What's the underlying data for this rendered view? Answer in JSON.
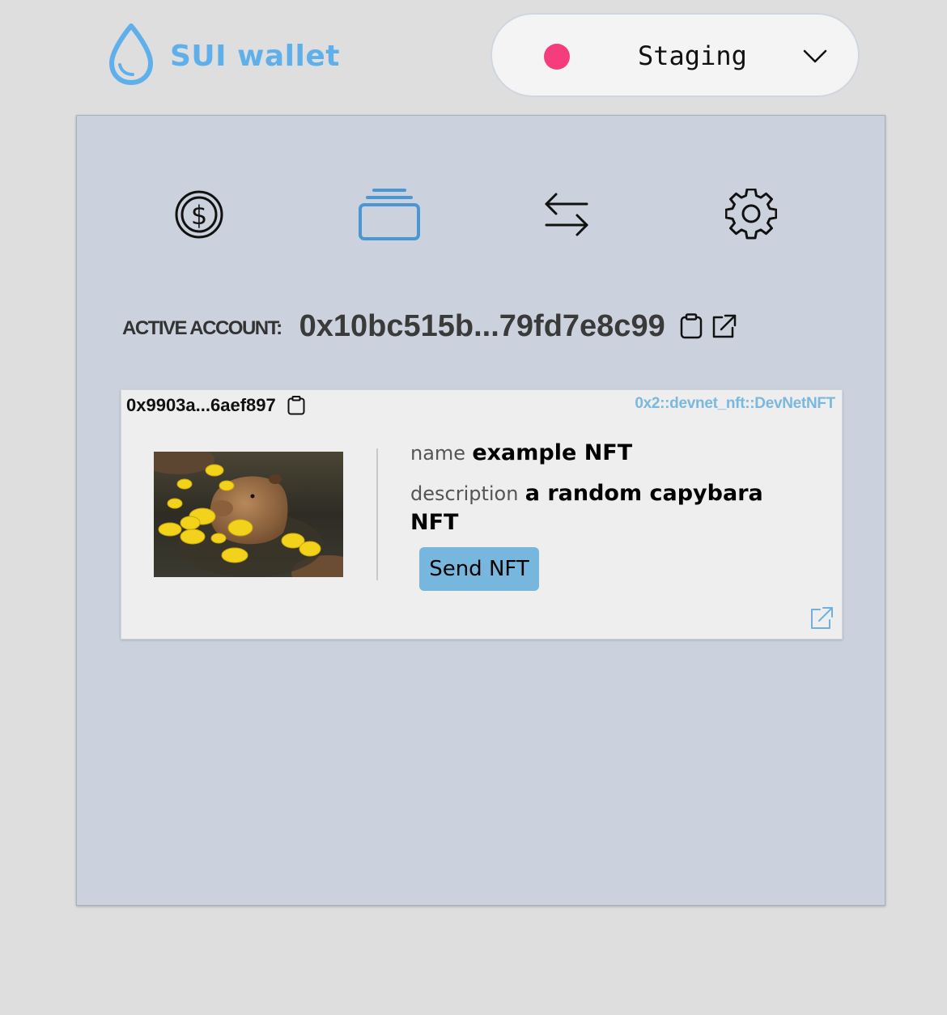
{
  "app": {
    "name": "SUI wallet",
    "logo_icon": "droplet-icon",
    "brand_color": "#5fb0ea"
  },
  "network": {
    "label": "Staging",
    "status_color": "#f53d7e",
    "chevron_icon": "chevron-down-icon"
  },
  "nav": {
    "items": [
      {
        "name": "tokens",
        "icon": "dollar-coin-icon",
        "active": false
      },
      {
        "name": "nfts",
        "icon": "cards-stack-icon",
        "active": true
      },
      {
        "name": "transactions",
        "icon": "arrows-swap-icon",
        "active": false
      },
      {
        "name": "settings",
        "icon": "gear-icon",
        "active": false
      }
    ],
    "active_color": "#4a97d4"
  },
  "account": {
    "label": "ACTIVE ACCOUNT:",
    "address": "0x10bc515b...79fd7e8c99",
    "copy_icon": "clipboard-icon",
    "explorer_icon": "external-link-icon"
  },
  "nft": {
    "id": "0x9903a...6aef897",
    "type": "0x2::devnet_nft::DevNetNFT",
    "image_alt": "capybara in water with yuzu fruit",
    "attributes": [
      {
        "key": "name",
        "value": "example NFT"
      },
      {
        "key": "description",
        "value": "a random capybara NFT"
      }
    ],
    "send_label": "Send NFT",
    "accent_color": "#78b7dd"
  }
}
